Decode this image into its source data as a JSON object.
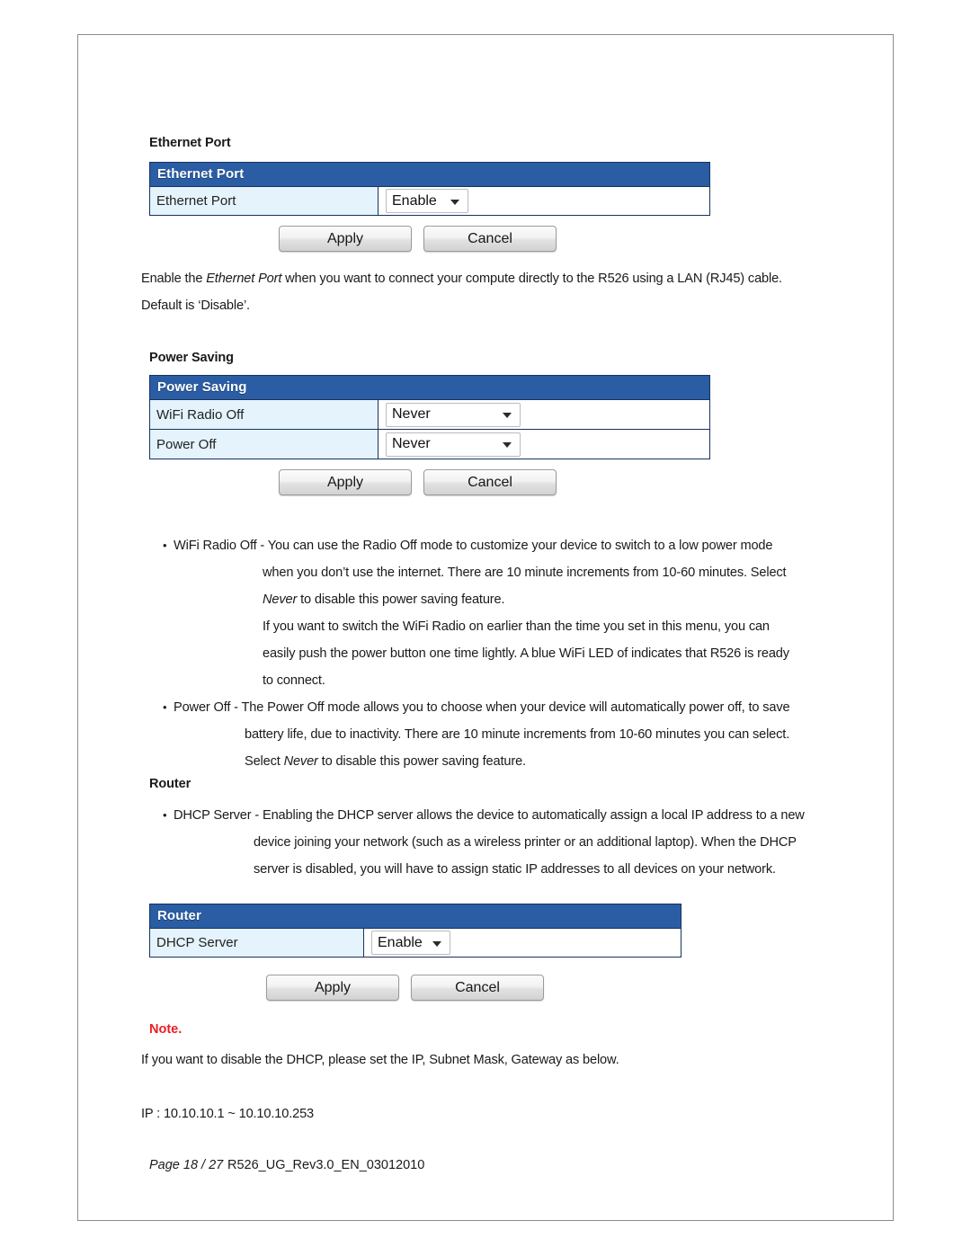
{
  "document": {
    "sections": {
      "ethernet_port_heading": "Ethernet Port",
      "power_saving_heading": "Power Saving",
      "router_heading": "Router",
      "note_heading": "Note."
    },
    "ethernet_paragraph": [
      {
        "pre": "Enable the ",
        "em": "Ethernet Port",
        "post": " when you want to connect your compute directly to the R526 using a LAN (RJ45) cable."
      },
      {
        "pre": "Default is ‘Disable’.",
        "em": "",
        "post": ""
      }
    ],
    "power_saving_bullets": [
      {
        "marker": "•",
        "lines": [
          {
            "pre": "WiFi Radio Off - You can use the Radio Off mode to customize your device to switch to a low power mode",
            "em": "",
            "post": ""
          },
          {
            "pre": "when you don’t use the internet. There are 10 minute increments from 10-60 minutes. Select",
            "em": "",
            "post": ""
          },
          {
            "pre": "",
            "em": "Never",
            "post": " to disable this power saving feature."
          },
          {
            "pre": "If you want to switch the WiFi Radio on earlier than the time you set in this menu, you can",
            "em": "",
            "post": ""
          },
          {
            "pre": "easily push the power button one time lightly. A blue WiFi LED of indicates that R526 is ready",
            "em": "",
            "post": ""
          },
          {
            "pre": "to connect.",
            "em": "",
            "post": ""
          }
        ]
      },
      {
        "marker": "•",
        "lines": [
          {
            "pre": "Power Off - The Power Off mode allows you to choose when your device will automatically power off, to save",
            "em": "",
            "post": ""
          },
          {
            "pre": "battery life, due to inactivity. There are 10 minute increments from 10-60 minutes you can select.",
            "em": "",
            "post": ""
          },
          {
            "pre": "Select ",
            "em": "Never",
            "post": " to disable this power saving feature."
          }
        ]
      }
    ],
    "router_bullets": [
      {
        "marker": "•",
        "lines": [
          {
            "pre": "DHCP Server - Enabling the DHCP server allows the device to automatically assign a local IP address to a new",
            "em": "",
            "post": ""
          },
          {
            "pre": "device joining your network (such as a wireless printer or an additional laptop). When the DHCP",
            "em": "",
            "post": ""
          },
          {
            "pre": "server is disabled, you will have to assign static IP addresses to all devices on your network.",
            "em": "",
            "post": ""
          }
        ]
      }
    ],
    "note_body": [
      "If you want to disable the DHCP, please set the IP, Subnet Mask, Gateway as below.",
      "IP : 10.10.10.1 ~ 10.10.10.253"
    ]
  },
  "panels": {
    "ethernet": {
      "title": "Ethernet Port",
      "rows": [
        {
          "label": "Ethernet Port",
          "value": "Enable",
          "caret": "chevron-down-icon"
        }
      ],
      "buttons": {
        "apply": "Apply",
        "cancel": "Cancel"
      }
    },
    "power_saving": {
      "title": "Power Saving",
      "rows": [
        {
          "label": "WiFi Radio Off",
          "value": "Never",
          "caret": "chevron-down-icon"
        },
        {
          "label": "Power Off",
          "value": "Never",
          "caret": "chevron-down-icon"
        }
      ],
      "buttons": {
        "apply": "Apply",
        "cancel": "Cancel"
      }
    },
    "router": {
      "title": "Router",
      "rows": [
        {
          "label": "DHCP Server",
          "value": "Enable",
          "caret": "chevron-down-icon"
        }
      ],
      "buttons": {
        "apply": "Apply",
        "cancel": "Cancel"
      }
    }
  },
  "footer": {
    "page_label": "Page 18 / 27",
    "revision": "R526_UG_Rev3.0_EN_03012010"
  },
  "colors": {
    "panel_header_blue": "#2a5da3",
    "panel_border_blue": "#17335e",
    "row_label_blue": "#e4f3fc",
    "note_red": "#ee1c25",
    "page_border_gray": "#8b8b8b"
  }
}
